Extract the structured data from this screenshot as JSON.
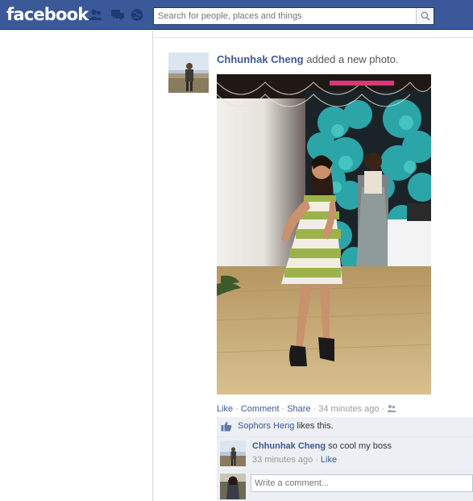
{
  "header": {
    "logo_text": "facebook",
    "jewels": [
      "friends-icon",
      "messages-icon",
      "notifications-icon"
    ],
    "search": {
      "placeholder": "Search for people, places and things",
      "button_icon": "search-icon"
    },
    "colors": {
      "bar": "#3b5998",
      "link": "#3b5998"
    }
  },
  "story": {
    "author": "Chhunhak Cheng",
    "action_text": "added a new photo.",
    "actions": {
      "like": "Like",
      "comment": "Comment",
      "share": "Share",
      "time": "34 minutes ago",
      "audience_icon": "friends-audience-icon"
    }
  },
  "likes": {
    "name": "Sophors Heng",
    "text": "likes this.",
    "icon": "thumbs-up-icon"
  },
  "comment": {
    "author": "Chhunhak Cheng",
    "text": "so cool my boss",
    "time": "33 minutes ago",
    "like": "Like"
  },
  "write_comment": {
    "placeholder": "Write a comment..."
  }
}
